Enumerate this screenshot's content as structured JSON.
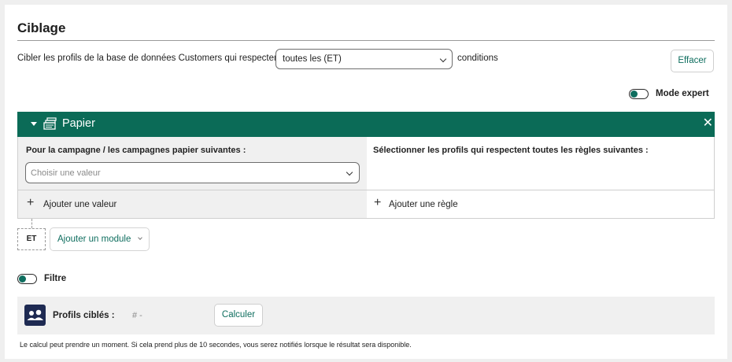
{
  "section": {
    "title": "Ciblage"
  },
  "targeting": {
    "prefix_text": "Cibler les profils de la base de données Customers qui respectent",
    "condition_select_value": "toutes les (ET)",
    "suffix_text": "conditions",
    "clear_button": "Effacer"
  },
  "expert_mode": {
    "label": "Mode expert",
    "enabled": false
  },
  "module": {
    "title": "Papier",
    "icon": "paper-stack-icon",
    "left_column": {
      "label": "Pour la campagne / les campagnes papier suivantes :",
      "select_placeholder": "Choisir une valeur",
      "add_value": "Ajouter une valeur"
    },
    "right_column": {
      "label": "Sélectionner les profils qui respectent toutes les règles suivantes :",
      "add_rule": "Ajouter une règle"
    }
  },
  "module_actions": {
    "operator_badge": "ET",
    "add_module": "Ajouter un module"
  },
  "filter": {
    "label": "Filtre",
    "enabled": false
  },
  "result": {
    "label": "Profils ciblés :",
    "count_placeholder": "# -",
    "calculate_button": "Calculer"
  },
  "footnote": "Le calcul peut prendre un moment. Si cela prend plus de 10 secondes, vous serez notifiés lorsque le résultat sera disponible.",
  "colors": {
    "brand_green": "#0b6b57",
    "accent_text": "#0f6e5f",
    "avatar_bg": "#1e2a52"
  }
}
